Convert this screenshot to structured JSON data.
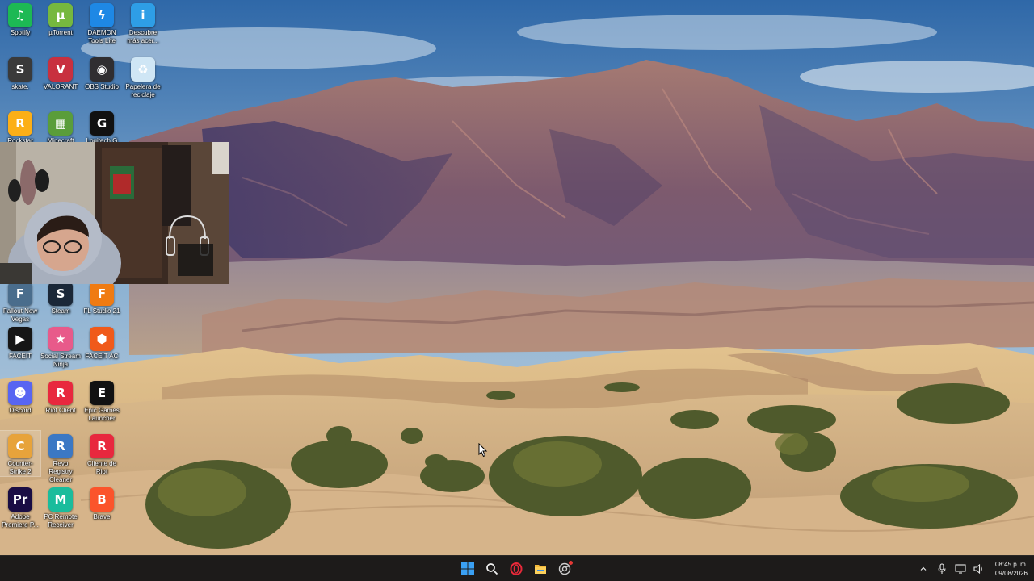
{
  "desktop": {
    "icons": [
      {
        "id": "spotify",
        "label": "Spotify",
        "icon": "spotify-icon",
        "color": "#1db954",
        "glyph": "♫"
      },
      {
        "id": "utorrent",
        "label": "µTorrent",
        "icon": "utorrent-icon",
        "color": "#76b83f",
        "glyph": "µ"
      },
      {
        "id": "daemon",
        "label": "DAEMON Tools Lite",
        "icon": "daemon-tools-icon",
        "color": "#1e88e5",
        "glyph": "ϟ"
      },
      {
        "id": "descubre",
        "label": "Descubre más acer...",
        "icon": "spotlight-icon",
        "color": "#2e9ee6",
        "glyph": "i"
      },
      {
        "id": "skate",
        "label": "skate.",
        "icon": "skate-icon",
        "color": "#3a3a3a",
        "glyph": "S"
      },
      {
        "id": "valorant",
        "label": "VALORANT",
        "icon": "valorant-icon",
        "color": "#c8303f",
        "glyph": "V"
      },
      {
        "id": "obs",
        "label": "OBS Studio",
        "icon": "obs-icon",
        "color": "#302e31",
        "glyph": "◉"
      },
      {
        "id": "papelera",
        "label": "Papelera de reciclaje",
        "icon": "recycle-bin-icon",
        "color": "#cfe6f5",
        "glyph": "♻"
      },
      {
        "id": "rockstar",
        "label": "Rockstar",
        "icon": "rockstar-icon",
        "color": "#fcaf17",
        "glyph": "R"
      },
      {
        "id": "minecraft",
        "label": "Minecraft",
        "icon": "minecraft-icon",
        "color": "#5a9d3a",
        "glyph": "▦"
      },
      {
        "id": "logitech",
        "label": "Logitech G",
        "icon": "logitech-icon",
        "color": "#111111",
        "glyph": "G"
      },
      {
        "id": "fallout",
        "label": "Fallout New Vegas",
        "icon": "fallout-icon",
        "color": "#4a6d8c",
        "glyph": "F"
      },
      {
        "id": "steam",
        "label": "Steam",
        "icon": "steam-icon",
        "color": "#1b2838",
        "glyph": "S"
      },
      {
        "id": "flstudio",
        "label": "FL Studio 21",
        "icon": "fl-studio-icon",
        "color": "#f07b12",
        "glyph": "F"
      },
      {
        "id": "faceit",
        "label": "FACEIT",
        "icon": "faceit-icon",
        "color": "#161616",
        "glyph": "▶"
      },
      {
        "id": "ssn",
        "label": "Social Stream Ninja",
        "icon": "social-stream-ninja-icon",
        "color": "#e85a8a",
        "glyph": "★"
      },
      {
        "id": "faceitac",
        "label": "FACEIT AC",
        "icon": "faceit-ac-icon",
        "color": "#f05a1a",
        "glyph": "⬢"
      },
      {
        "id": "discord",
        "label": "Discord",
        "icon": "discord-icon",
        "color": "#5865f2",
        "glyph": "☻"
      },
      {
        "id": "riotclient",
        "label": "Riot Client",
        "icon": "riot-client-icon",
        "color": "#e8283e",
        "glyph": "R"
      },
      {
        "id": "epic",
        "label": "Epic Games Launcher",
        "icon": "epic-games-icon",
        "color": "#121212",
        "glyph": "E"
      },
      {
        "id": "cs",
        "label": "Counter-Strike 2",
        "icon": "counter-strike-icon",
        "color": "#e7a33b",
        "glyph": "C"
      },
      {
        "id": "revo",
        "label": "Revo Registry Cleaner",
        "icon": "revo-registry-cleaner-icon",
        "color": "#3b78c4",
        "glyph": "R"
      },
      {
        "id": "clienteriot",
        "label": "Cliente de Riot",
        "icon": "cliente-riot-icon",
        "color": "#e8283e",
        "glyph": "R"
      },
      {
        "id": "premiere",
        "label": "Adobe Premiere P...",
        "icon": "premiere-icon",
        "color": "#1a0d44",
        "glyph": "Pr"
      },
      {
        "id": "pcremote",
        "label": "PC Remote Receiver",
        "icon": "pc-remote-icon",
        "color": "#1abc9c",
        "glyph": "M"
      },
      {
        "id": "brave",
        "label": "Brave",
        "icon": "brave-icon",
        "color": "#fb542b",
        "glyph": "B"
      }
    ]
  },
  "taskbar": {
    "apps": [
      {
        "id": "start",
        "icon": "windows-start-icon"
      },
      {
        "id": "search",
        "icon": "search-icon"
      },
      {
        "id": "opera",
        "icon": "opera-gx-icon"
      },
      {
        "id": "explorer",
        "icon": "file-explorer-icon"
      },
      {
        "id": "settings",
        "icon": "chrome-icon"
      }
    ],
    "tray": {
      "chevron": "^",
      "time": "08:45 p. m.",
      "date": "09/08/2026"
    }
  },
  "colors": {
    "taskbar_bg": "#1d1b1a",
    "start_blue": "#3aa0f3"
  }
}
